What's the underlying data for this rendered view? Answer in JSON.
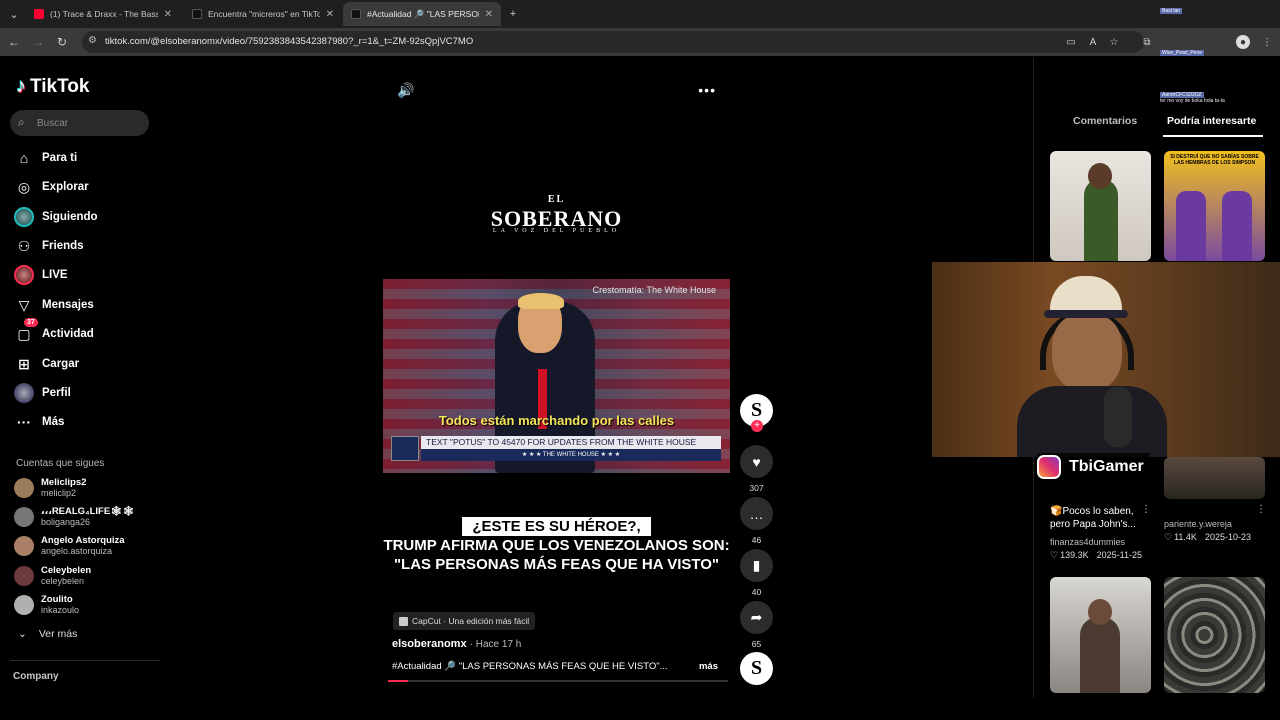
{
  "browser": {
    "tabs": [
      {
        "title": "(1) Trace & Draxx - The Bass - Y",
        "color": "#ff0033"
      },
      {
        "title": "Encuentra \"micreros\" en TikTok |",
        "color": "#000000"
      },
      {
        "title": "#Actualidad 🔎 \"LAS PERSONAS",
        "color": "#000000"
      }
    ],
    "url": "tiktok.com/@elsoberanomx/video/7592383843542387980?_r=1&_t=ZM-92sQpjVC7MO"
  },
  "sidebar": {
    "logo": "TikTok",
    "search_placeholder": "Buscar",
    "nav": [
      {
        "label": "Para ti",
        "icon": "home-icon"
      },
      {
        "label": "Explorar",
        "icon": "compass-icon"
      },
      {
        "label": "Siguiendo",
        "icon": "avatar"
      },
      {
        "label": "Friends",
        "icon": "friends-icon"
      },
      {
        "label": "LIVE",
        "icon": "live-avatar"
      },
      {
        "label": "Mensajes",
        "icon": "send-icon"
      },
      {
        "label": "Actividad",
        "icon": "activity-icon",
        "badge": "37"
      },
      {
        "label": "Cargar",
        "icon": "upload-icon"
      },
      {
        "label": "Perfil",
        "icon": "profile-avatar"
      },
      {
        "label": "Más",
        "icon": "more-icon"
      }
    ],
    "follows_title": "Cuentas que sigues",
    "follows": [
      {
        "name": "Meliclips2",
        "handle": "meliclip2"
      },
      {
        "name": "،،،REALG₄LIFE🕸🕸",
        "handle": "boliganga26"
      },
      {
        "name": "Angelo Astorquiza",
        "handle": "angelo.astorquiza"
      },
      {
        "name": "Celeybelen",
        "handle": "celeybelen"
      },
      {
        "name": "Zoulito",
        "handle": "inkazoulo"
      }
    ],
    "see_more": "Ver más",
    "company": "Company"
  },
  "video": {
    "brand_top": "EL",
    "brand": "SOBERANO",
    "brand_sub": "LA VOZ DEL PUEBLO",
    "credit": "Crestomatía: The White House",
    "subtitle": "Todos están marchando por las calles",
    "ticker": "TEXT \"POTUS\" TO 45470 FOR UPDATES FROM THE WHITE HOUSE",
    "ticker2": "★ ★ ★   THE WHITE HOUSE   ★ ★ ★",
    "headline_1": "¿ESTE ES SU HÉROE?,",
    "headline_2": "TRUMP AFIRMA QUE LOS VENEZOLANOS SON: \"LAS PERSONAS MÁS FEAS QUE HA VISTO\"",
    "capcut": "CapCut · Una edición más fácil",
    "author": "elsoberanomx",
    "time": "· Hace 17 h",
    "description": "#Actualidad 🔎 \"LAS PERSONAS MÁS FEAS QUE HE VISTO\"...",
    "more": "más",
    "progress": 0.06
  },
  "actions": {
    "likes": "307",
    "comments": "46",
    "saves": "40",
    "shares": "65"
  },
  "right": {
    "tab_comments": "Comentarios",
    "tab_related": "Podría interesarte",
    "cards": [
      {
        "title": "🍞Pocos lo saben, pero Papa John's...",
        "user": "finanzas4dummies",
        "likes": "139.3K",
        "date": "2025-11-25"
      },
      {
        "title": "",
        "user": "pariente.y.wereja",
        "likes": "11.4K",
        "date": "2025-10-23"
      }
    ],
    "thumb_texts": [
      "SI DESTRUÍ QUE NO SABÍAS SOBRE LAS HEMBRAS DE LOS SIMPSON"
    ]
  },
  "overlay": {
    "streamer": "TbiGamer",
    "chat_user1": "Bast lan",
    "chat_user2": "Wise_Pearl_Pene",
    "chat_user3": "AaronCFC1D2OZ",
    "chat_msg3": "ter mo voy de boka hola ta-ta"
  }
}
